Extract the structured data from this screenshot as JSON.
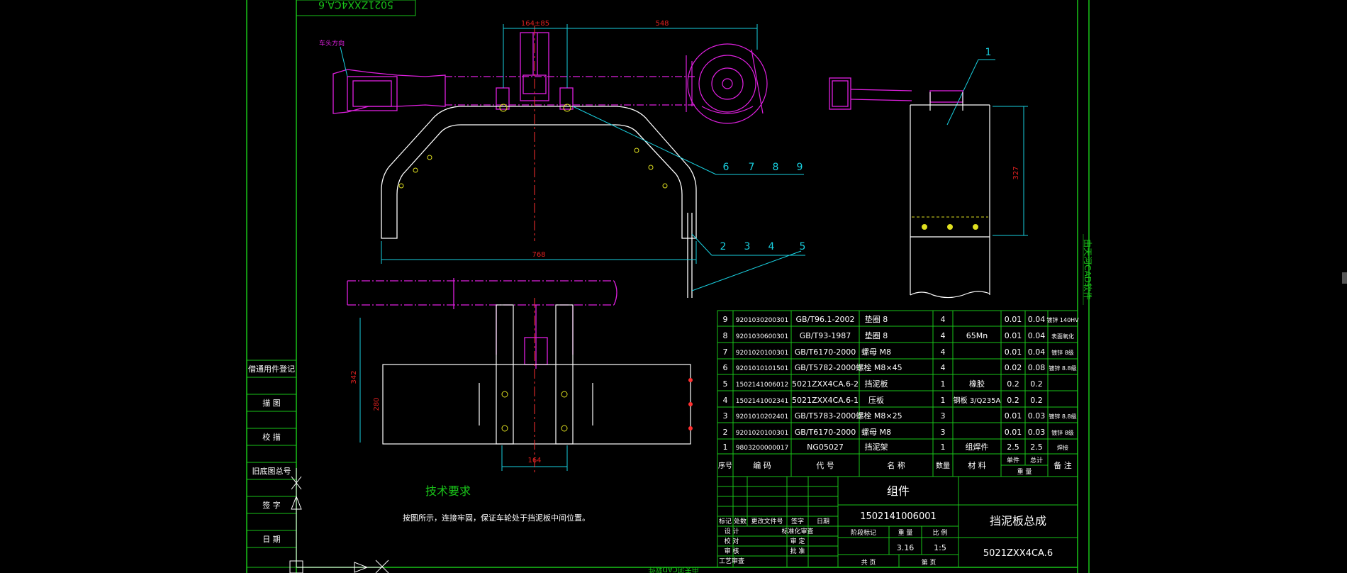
{
  "title_strip_mirrored": "5021ZXX4CA.6",
  "side_label": "由天河CAD软件",
  "bottom_mirror_label": "由天河CAD软件",
  "vehicle_direction_label": "车头方向",
  "dims": {
    "d164_85": "164±85",
    "d548": "548",
    "d768": "768",
    "d327": "327",
    "d342": "342",
    "d280": "280",
    "d164": "164"
  },
  "balloons": {
    "b1": "1",
    "b6": "6",
    "b7": "7",
    "b8": "8",
    "b9": "9",
    "b2": "2",
    "b3": "3",
    "b4": "4",
    "b5": "5"
  },
  "tech_requirements": {
    "title": "技术要求",
    "text": "按图所示，连接牢固，保证车轮处于挡泥板中间位置。"
  },
  "left_panel": {
    "items": [
      "借通用件登记",
      "描 图",
      "校 描",
      "旧底图总号",
      "签 字",
      "日 期"
    ]
  },
  "bom": {
    "rows": [
      {
        "no": "9",
        "code": "9201030200301",
        "std": "GB/T96.1-2002",
        "name": "垫圈 8",
        "qty": "4",
        "mat": "",
        "w1": "0.01",
        "w2": "0.04",
        "note": "镀锌 140HV"
      },
      {
        "no": "8",
        "code": "9201030600301",
        "std": "GB/T93-1987",
        "name": "垫圈 8",
        "qty": "4",
        "mat": "65Mn",
        "w1": "0.01",
        "w2": "0.04",
        "note": "表面氧化"
      },
      {
        "no": "7",
        "code": "9201020100301",
        "std": "GB/T6170-2000",
        "name": "螺母 M8",
        "qty": "4",
        "mat": "",
        "w1": "0.01",
        "w2": "0.04",
        "note": "镀锌 8级"
      },
      {
        "no": "6",
        "code": "9201010101501",
        "std": "GB/T5782-2000",
        "name": "螺栓 M8×45",
        "qty": "4",
        "mat": "",
        "w1": "0.02",
        "w2": "0.08",
        "note": "镀锌 8.8级"
      },
      {
        "no": "5",
        "code": "1502141006012",
        "std": "5021ZXX4CA.6-2",
        "name": "挡泥板",
        "qty": "1",
        "mat": "橡胶",
        "w1": "0.2",
        "w2": "0.2",
        "note": ""
      },
      {
        "no": "4",
        "code": "1502141002341",
        "std": "5021ZXX4CA.6-1",
        "name": "压板",
        "qty": "1",
        "mat": "钢板 3/Q235A",
        "w1": "0.2",
        "w2": "0.2",
        "note": ""
      },
      {
        "no": "3",
        "code": "9201010202401",
        "std": "GB/T5783-2000",
        "name": "螺栓 M8×25",
        "qty": "3",
        "mat": "",
        "w1": "0.01",
        "w2": "0.03",
        "note": "镀锌 8.8级"
      },
      {
        "no": "2",
        "code": "9201020100301",
        "std": "GB/T6170-2000",
        "name": "螺母 M8",
        "qty": "3",
        "mat": "",
        "w1": "0.01",
        "w2": "0.03",
        "note": "镀锌 8级"
      },
      {
        "no": "1",
        "code": "9803200000017",
        "std": "NG05027",
        "name": "挡泥架",
        "qty": "1",
        "mat": "组焊件",
        "w1": "2.5",
        "w2": "2.5",
        "note": "焊接"
      }
    ],
    "header": {
      "no": "序号",
      "code": "编 码",
      "std": "代 号",
      "name": "名 称",
      "qty": "数量",
      "mat": "材 料",
      "w1": "单件",
      "w2": "总计",
      "weight": "重 量",
      "note": "备 注"
    }
  },
  "title_block": {
    "group_label": "组件",
    "part_code": "1502141006001",
    "assembly_name": "挡泥板总成",
    "drawing_no": "5021ZXX4CA.6",
    "weight": "3.16",
    "scale": "1:5",
    "scale_label": "比 例",
    "weight_label": "重 量",
    "stage_label": "阶段标记",
    "sheets_total": "共 页",
    "sheet_no": "第 页",
    "rev_cols": [
      "标记",
      "处数",
      "更改文件号",
      "签字",
      "日期"
    ],
    "roles": [
      "设 计",
      "校 对",
      "审 核",
      "工艺审查"
    ],
    "roles2": [
      "标准化审查",
      "审 定",
      "批 准"
    ]
  }
}
